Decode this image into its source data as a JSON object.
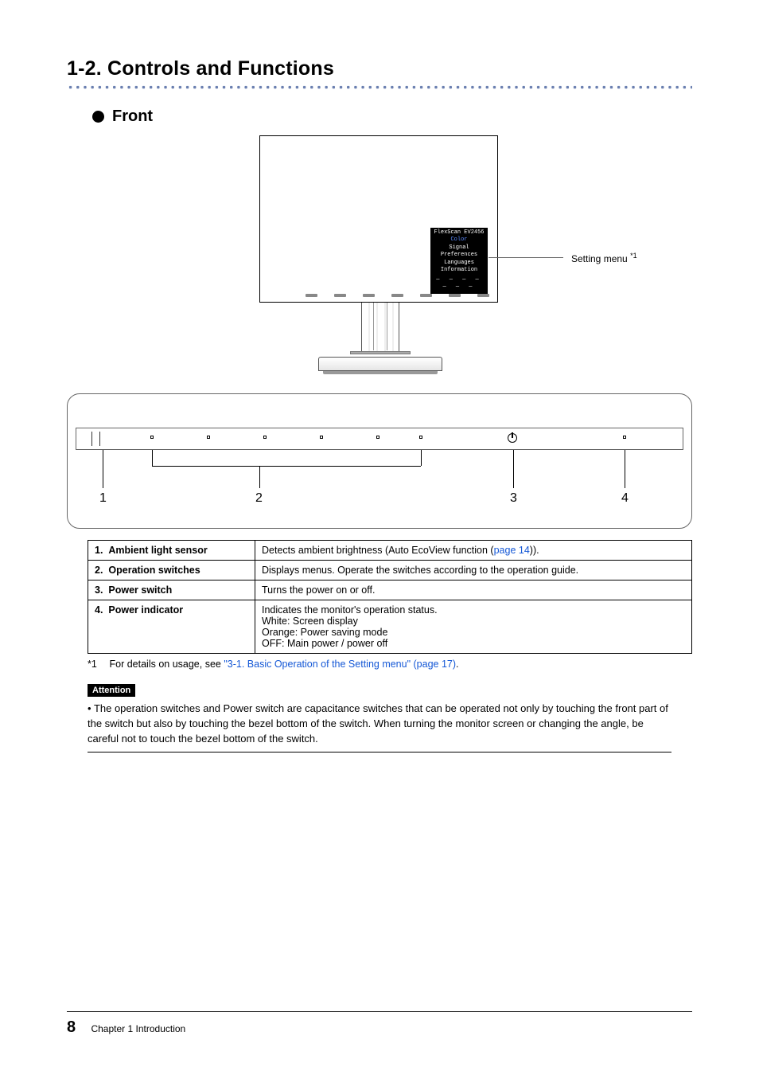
{
  "heading": "1-2.  Controls and Functions",
  "subheading": "Front",
  "osd": {
    "title": "FlexScan EV2456",
    "items": [
      "Color",
      "Signal",
      "Preferences",
      "Languages",
      "Information"
    ],
    "label": "Setting menu",
    "label_sup": "*1"
  },
  "bezel_callouts": {
    "n1": "1",
    "n2": "2",
    "n3": "3",
    "n4": "4"
  },
  "table": {
    "rows": [
      {
        "num": "1.",
        "name": "Ambient light sensor",
        "desc_pre": "Detects ambient brightness (Auto EcoView function (",
        "desc_link": "page 14",
        "desc_post": "))."
      },
      {
        "num": "2.",
        "name": "Operation switches",
        "desc": "Displays menus. Operate the switches according to the operation guide."
      },
      {
        "num": "3.",
        "name": "Power switch",
        "desc": "Turns the power on or off."
      },
      {
        "num": "4.",
        "name": "Power indicator",
        "lines": [
          "Indicates the monitor's operation status.",
          "White:  Screen display",
          "Orange:  Power saving mode",
          "OFF:  Main power / power off"
        ]
      }
    ]
  },
  "footnote": {
    "num": "*1",
    "pre": "For details on usage, see ",
    "link": "\"3-1. Basic Operation of the Setting menu\" (page 17)",
    "post": "."
  },
  "attention": {
    "label": "Attention",
    "text": "The operation switches and Power switch are capacitance switches that can be operated not only by touching the front part of the switch but also by touching the bezel bottom of the switch. When turning the monitor screen or changing the angle, be careful not to touch the bezel bottom of the switch."
  },
  "footer": {
    "page": "8",
    "chapter": "Chapter 1 Introduction"
  }
}
